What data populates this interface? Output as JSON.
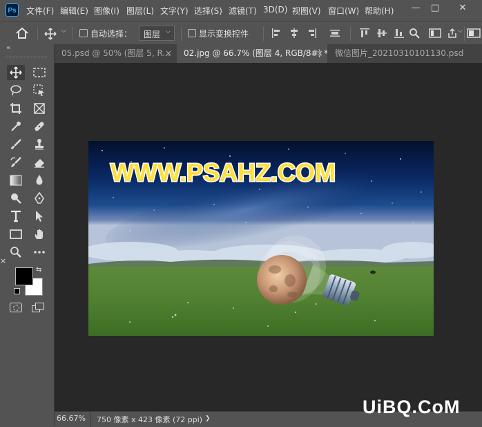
{
  "app": {
    "logo": "Ps"
  },
  "menu": [
    "文件(F)",
    "编辑(E)",
    "图像(I)",
    "图层(L)",
    "文字(Y)",
    "选择(S)",
    "滤镜(T)",
    "3D(D)",
    "视图(V)",
    "窗口(W)",
    "帮助(H)"
  ],
  "window_controls": {
    "minimize": "—",
    "maximize": "□",
    "close": "✕"
  },
  "options": {
    "auto_select_label": "自动选择：",
    "auto_select_value": "图层",
    "show_transform_label": "显示变换控件"
  },
  "tabs": [
    {
      "label": "05.psd @ 50% (图层 5, R...",
      "active": false,
      "close": "×"
    },
    {
      "label": "02.jpg @ 66.7% (图层 4, RGB/8#) *",
      "active": true,
      "close": "×"
    },
    {
      "label": "微信图片_20210310101130.psd",
      "active": false,
      "close": ""
    }
  ],
  "canvas": {
    "overlay_text": "WWW.PSAHZ.COM"
  },
  "status": {
    "zoom": "66.67%",
    "doc_info": "750 像素 x 423 像素 (72 ppi)",
    "arrow": "❯"
  },
  "watermark": "UiBQ.CoM",
  "colors": {
    "foreground": "#000000",
    "background": "#ffffff",
    "accent": "#31a8ff"
  },
  "tools": [
    [
      "move-tool-icon",
      "marquee-tool-icon"
    ],
    [
      "lasso-tool-icon",
      "object-select-tool-icon"
    ],
    [
      "crop-tool-icon",
      "frame-tool-icon"
    ],
    [
      "eyedropper-tool-icon",
      "healing-brush-tool-icon"
    ],
    [
      "brush-tool-icon",
      "clone-stamp-tool-icon"
    ],
    [
      "history-brush-tool-icon",
      "eraser-tool-icon"
    ],
    [
      "gradient-tool-icon",
      "blur-tool-icon"
    ],
    [
      "dodge-tool-icon",
      "pen-tool-icon"
    ],
    [
      "type-tool-icon",
      "path-select-tool-icon"
    ],
    [
      "rectangle-tool-icon",
      "hand-tool-icon"
    ],
    [
      "zoom-tool-icon",
      "more-tools-icon"
    ]
  ]
}
